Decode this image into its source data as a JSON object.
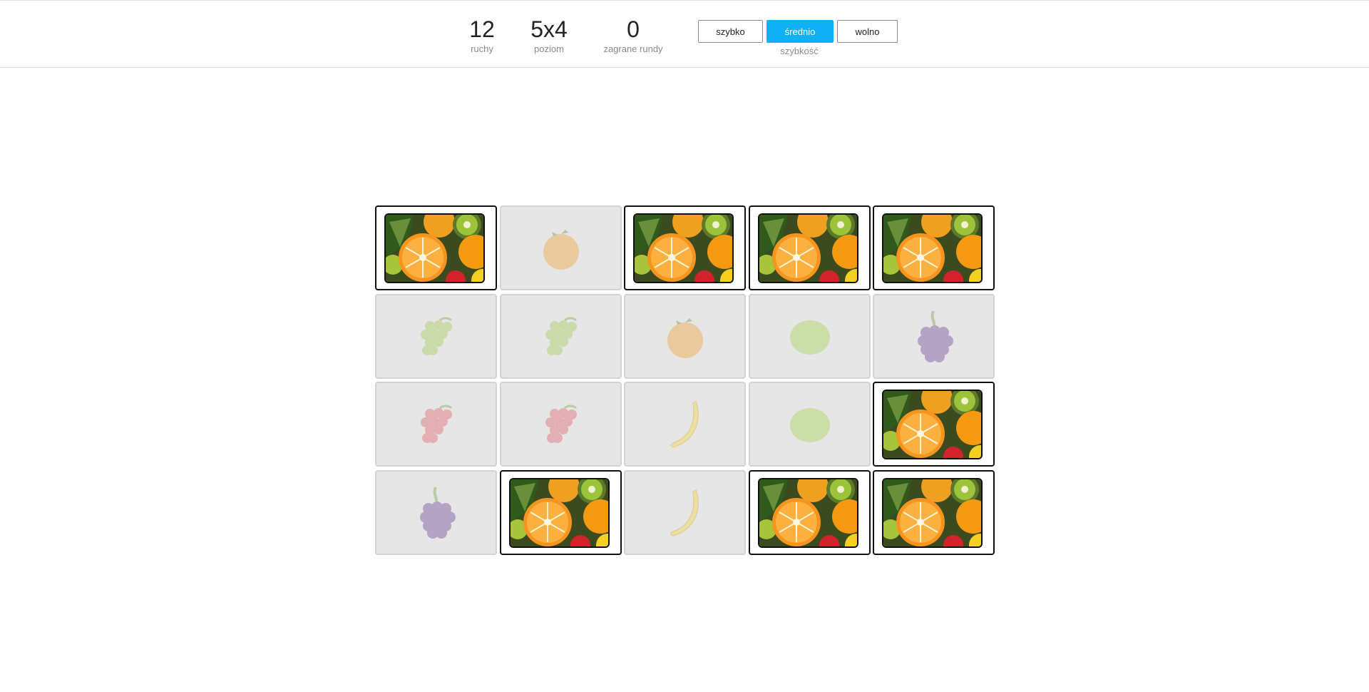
{
  "header": {
    "moves": {
      "value": "12",
      "label": "ruchy"
    },
    "level": {
      "value": "5x4",
      "label": "poziom"
    },
    "rounds": {
      "value": "0",
      "label": "zagrane rundy"
    },
    "speed": {
      "label": "szybkość",
      "options": [
        "szybko",
        "średnio",
        "wolno"
      ],
      "selected": "średnio",
      "accent": "#0fb0f5"
    }
  },
  "board": {
    "columns": 5,
    "rows": 4,
    "cards": [
      {
        "state": "hidden"
      },
      {
        "state": "matched",
        "fruit": "orange"
      },
      {
        "state": "hidden"
      },
      {
        "state": "hidden"
      },
      {
        "state": "hidden"
      },
      {
        "state": "matched",
        "fruit": "green-grapes"
      },
      {
        "state": "matched",
        "fruit": "green-grapes"
      },
      {
        "state": "matched",
        "fruit": "orange"
      },
      {
        "state": "matched",
        "fruit": "lime"
      },
      {
        "state": "matched",
        "fruit": "blackberry"
      },
      {
        "state": "matched",
        "fruit": "red-grapes"
      },
      {
        "state": "matched",
        "fruit": "red-grapes"
      },
      {
        "state": "matched",
        "fruit": "banana"
      },
      {
        "state": "matched",
        "fruit": "lime"
      },
      {
        "state": "hidden"
      },
      {
        "state": "matched",
        "fruit": "blackberry"
      },
      {
        "state": "hidden"
      },
      {
        "state": "matched",
        "fruit": "banana"
      },
      {
        "state": "hidden"
      },
      {
        "state": "hidden"
      }
    ]
  }
}
